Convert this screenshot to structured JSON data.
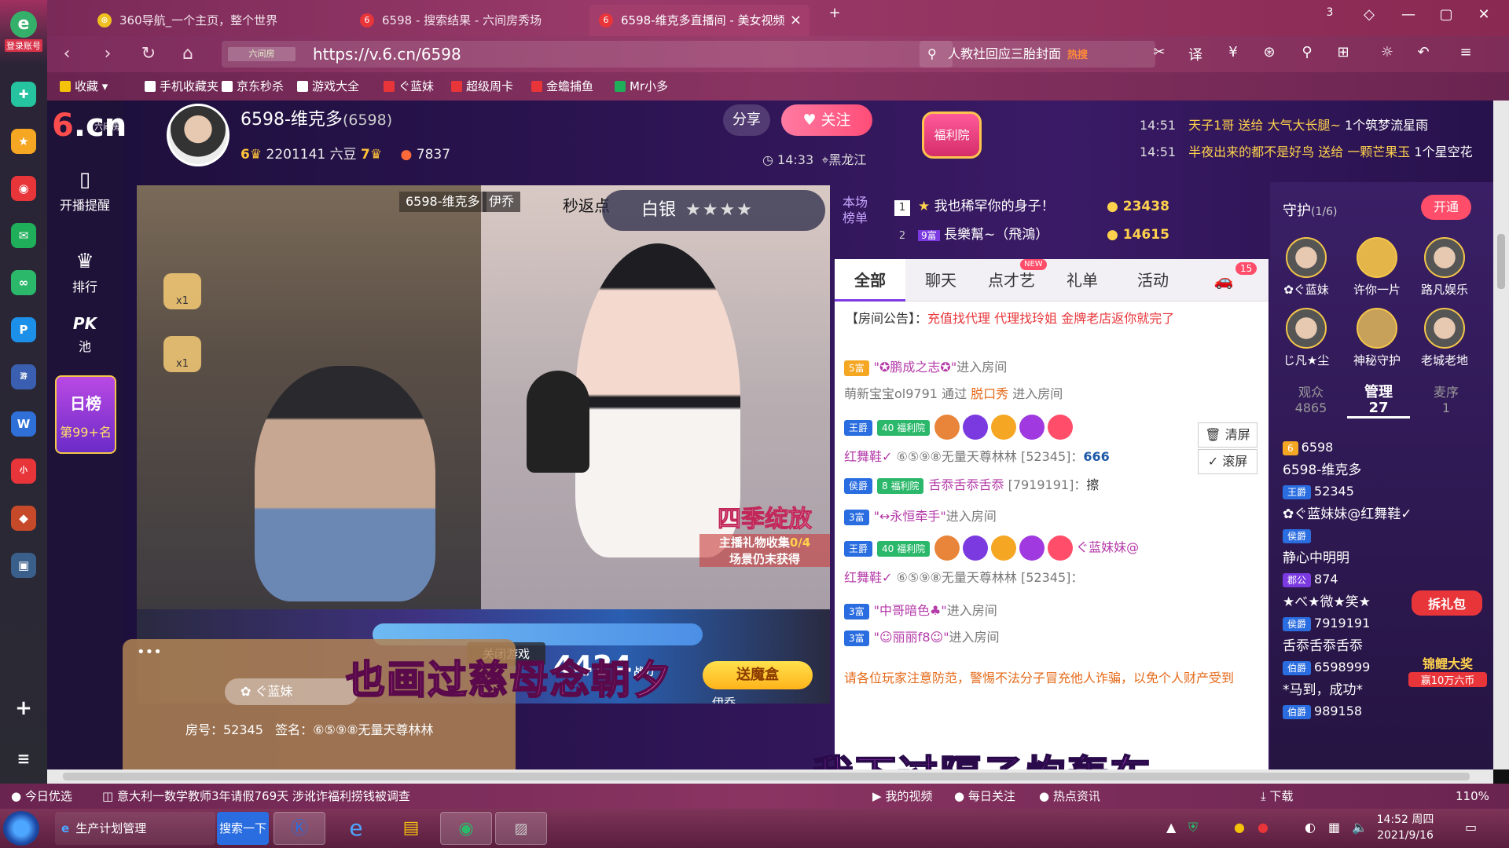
{
  "browser": {
    "login_label": "登录账号",
    "tabs": [
      {
        "label": "360导航_一个主页，整个世界",
        "icon_color": "#f0c020"
      },
      {
        "label": "6598 - 搜索结果 - 六间房秀场",
        "icon_color": "#e8353a"
      },
      {
        "label": "6598-维克多直播间 - 美女视频",
        "icon_color": "#e8353a"
      }
    ],
    "tab_counter": "3",
    "url_prefix": "六间房",
    "url": "https://v.6.cn/6598",
    "search_text": "人教社回应三胎封面",
    "search_hot": "热搜",
    "bookmarks": [
      "收藏",
      "手机收藏夹",
      "京东秒杀",
      "游戏大全",
      "ぐ蓝妹",
      "超级周卡",
      "金蟾捕鱼",
      "Mr小多"
    ],
    "zoom": "110%",
    "status_news": "意大利一数学教师3年请假769天 涉讹诈福利捞钱被调查",
    "status_today": "今日优选",
    "status_items": [
      "我的视频",
      "每日关注",
      "热点资讯",
      "下载"
    ]
  },
  "site": {
    "logo_main": "6.cn",
    "logo_sub": "六间房",
    "nav": [
      {
        "label": "开播提醒",
        "icon": "phone-icon"
      },
      {
        "label": "排行",
        "icon": "crown-icon"
      },
      {
        "label": "PK池",
        "icon": "pk-icon"
      }
    ],
    "dayrank_title": "日榜",
    "dayrank_sub": "第99+名"
  },
  "streamer": {
    "name": "6598-维克多",
    "room_id": "(6598)",
    "level_left": "6",
    "beans": "2201141 六豆",
    "level_right": "7",
    "fans": "7837",
    "share": "分享",
    "follow": "关注",
    "time": "14:33",
    "location": "黑龙江",
    "welfare": "福利院"
  },
  "gift_feed": [
    {
      "time": "14:51",
      "text_a": "天子1哥 送给 大气大长腿~",
      "text_b": "1个筑梦流星雨"
    },
    {
      "time": "14:51",
      "text_a": "半夜出来的都不是好鸟 送给 一颗芒果玉",
      "text_b": "1个星空花"
    }
  ],
  "video": {
    "left_tag": "6598-维克多",
    "right_tag": "伊乔",
    "return_text": "秒返点",
    "silver_label": "白银",
    "stars": "★★★★",
    "season_title": "四季绽放",
    "season_sub": "主播礼物收集",
    "season_count": "0/4",
    "season_sub2": "场景仍末获得",
    "close_game": "关闭游戏",
    "score": "4424",
    "score_unit": "战力",
    "pilot": "伊乔",
    "mofo_label": "送魔盒",
    "badge1": "x1",
    "badge2": "x1",
    "dock_user": "ぐ蓝妹",
    "dock_room": "房号：52345",
    "dock_sign": "签名：⑥⑤⑨⑧无量天尊林林",
    "subtitle1": "也画过慈母念朝夕",
    "subtitle2": "我下过隔子炮轰车"
  },
  "rank": {
    "title": "本场榜单",
    "rows": [
      {
        "num": "1",
        "name": "我也稀罕你的身子！",
        "coins": "23438"
      },
      {
        "num": "2",
        "name": "長樂幫~（飛鴻）",
        "coins": "14615",
        "tag": "9富"
      }
    ]
  },
  "chat": {
    "tabs": [
      "全部",
      "聊天",
      "点才艺",
      "礼单",
      "活动"
    ],
    "new_tag": "NEW",
    "car_count": "15",
    "notice_label": "【房间公告】：",
    "notice_text": "充值找代理 代理找玲姐 金牌老店返你就完了",
    "lines": [
      {
        "tag": "5富",
        "user": "✪鹏成之志✪",
        "suffix": "进入房间"
      },
      {
        "user": "萌新宝宝ol9791",
        "mid": "通过",
        "src": "脱口秀",
        "suffix": "进入房间"
      },
      {
        "tag": "王爵",
        "tag2": "40 福利院",
        "tail": "ぐ蓝妹妹@"
      },
      {
        "user": "红舞鞋✓",
        "text": "⑥⑤⑨⑧无量天尊林林",
        "room": "[52345]：",
        "msg": "666"
      },
      {
        "tag": "侯爵",
        "tag2": "8 福利院",
        "user": "舌忝舌忝舌忝",
        "room": "[7919191]：",
        "msg": "擦"
      },
      {
        "tag": "3富",
        "user": "↔永恒牵手",
        "suffix": "进入房间"
      },
      {
        "tag": "王爵",
        "tag2": "40 福利院",
        "tail": "ぐ蓝妹妹@"
      },
      {
        "user": "红舞鞋✓",
        "text": "⑥⑤⑨⑧无量天尊林林",
        "room": "[52345]："
      },
      {
        "tag": "3富",
        "user": "中哥暗色♣",
        "suffix": "进入房间"
      },
      {
        "tag": "3富",
        "user": "☺丽丽f8☺",
        "suffix": "进入房间"
      }
    ],
    "clear": "清屏",
    "scroll": "滚屏",
    "warn": "请各位玩家注意防范，警惕不法分子冒充他人诈骗，以免个人财产受到"
  },
  "guard": {
    "title": "守护",
    "count": "(1/6)",
    "open": "开通",
    "avatars": [
      "✿ぐ蓝妹",
      "许你一片",
      "路凡娱乐",
      "じ凡★尘",
      "神秘守护",
      "老城老地"
    ],
    "tabs": [
      {
        "label": "观众",
        "n": "4865"
      },
      {
        "label": "管理",
        "n": "27"
      },
      {
        "label": "麦序",
        "n": "1"
      }
    ],
    "list": [
      {
        "tag": "6",
        "a": "6598",
        "b": "6598-维克多"
      },
      {
        "tag": "王爵",
        "a": "52345",
        "b": "✿ぐ蓝妹妹@红舞鞋✓"
      },
      {
        "tag": "侯爵",
        "a": "",
        "b": "静心中明明"
      },
      {
        "tag": "郡公",
        "a": "874",
        "b": "★べ★微★笑★"
      },
      {
        "tag": "侯爵",
        "a": "7919191",
        "b": "舌忝舌忝舌忝"
      },
      {
        "tag": "伯爵",
        "a": "6598999",
        "b": "*马到，成功*"
      },
      {
        "tag": "伯爵",
        "a": "989158",
        "b": ""
      }
    ],
    "promo1": "拆礼包",
    "promo2": "锦鲤大奖",
    "promo3": "赢10万六币"
  },
  "taskbar": {
    "items": [
      "生产计划管理",
      "搜索一下"
    ],
    "time": "14:52 周四",
    "date": "2021/9/16"
  }
}
